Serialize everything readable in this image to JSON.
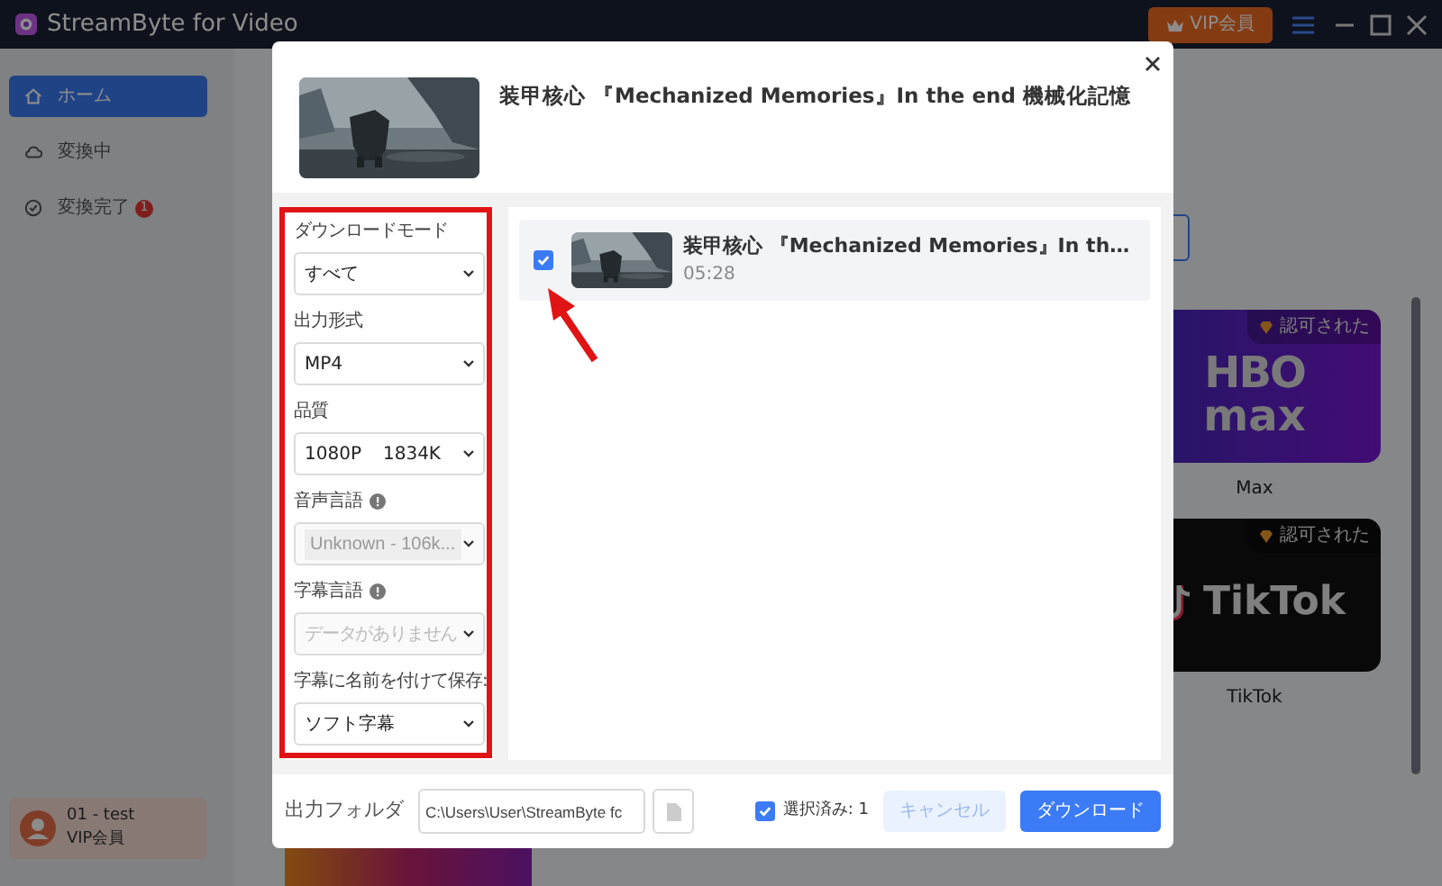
{
  "app": {
    "title": "StreamByte for Video",
    "vip_button": "VIP会員"
  },
  "sidebar": {
    "items": [
      {
        "label": "ホーム",
        "selected": true
      },
      {
        "label": "変換中",
        "selected": false
      },
      {
        "label": "変換完了",
        "selected": false,
        "badge": "1"
      }
    ],
    "user": {
      "name": "01 - test",
      "plan": "VIP会員"
    }
  },
  "services": [
    {
      "kind": "hbo",
      "logo": [
        "HBO",
        "max"
      ],
      "badge": "認可された",
      "name": "Max"
    },
    {
      "kind": "tiktok",
      "logo": [
        "TikTok"
      ],
      "badge": "認可された",
      "name": "TikTok"
    }
  ],
  "dialog": {
    "title": "装甲核心 『Mechanized Memories』In the end 機械化記憶",
    "options": [
      {
        "label": "ダウンロードモード",
        "value": "すべて"
      },
      {
        "label": "出力形式",
        "value": "MP4"
      },
      {
        "label": "品質",
        "values": [
          "1080P",
          "1834K"
        ]
      },
      {
        "label": "音声言語",
        "info": true,
        "disabled": true,
        "value": "Unknown - 106k..."
      },
      {
        "label": "字幕言語",
        "info": true,
        "disabled": true,
        "placeholder": "データがありません"
      },
      {
        "label": "字幕に名前を付けて保存:",
        "value": "ソフト字幕"
      }
    ],
    "videos": [
      {
        "title": "装甲核心 『Mechanized Memories』In th…",
        "duration": "05:28",
        "checked": true
      }
    ],
    "output_folder": {
      "label": "出力フォルダ",
      "value": "C:\\Users\\User\\StreamByte fc"
    },
    "select_all": {
      "label": "選択済み: 1",
      "checked": true
    },
    "buttons": [
      {
        "label": "キャンセル",
        "kind": "secondary"
      },
      {
        "label": "ダウンロード",
        "kind": "primary"
      }
    ]
  }
}
